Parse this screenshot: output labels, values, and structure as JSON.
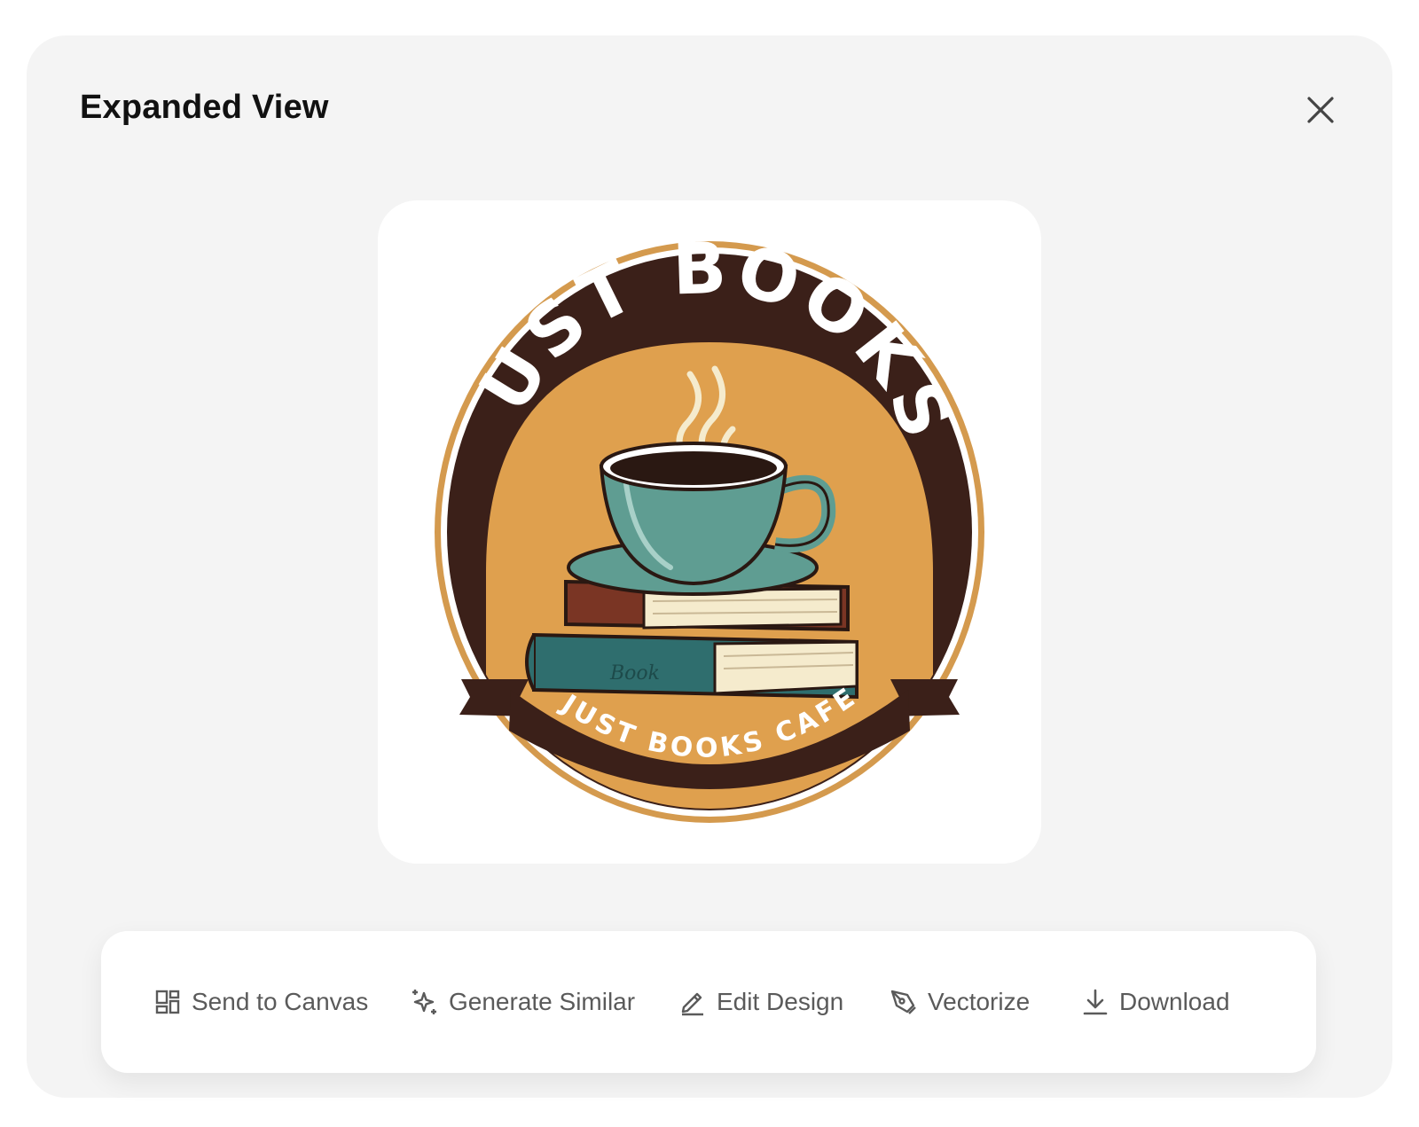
{
  "modal": {
    "title": "Expanded View",
    "close_icon": "close-icon"
  },
  "image": {
    "logo_top_text": "JUST BOOKS",
    "logo_banner_text": "JUST BOOKS CAFE",
    "book_spine_text": "Book",
    "colors": {
      "dark_brown": "#3b2019",
      "ring_gold": "#d49a4e",
      "orange": "#dfa04e",
      "teal": "#5f9d92",
      "dark_teal": "#2f6e6e",
      "cream": "#f5ebcd",
      "red_brown": "#7a3524"
    }
  },
  "toolbar": {
    "actions": [
      {
        "label": "Send to Canvas",
        "icon": "layout-grid-icon"
      },
      {
        "label": "Generate Similar",
        "icon": "sparkles-icon"
      },
      {
        "label": "Edit Design",
        "icon": "pencil-icon"
      },
      {
        "label": "Vectorize",
        "icon": "pen-tool-icon"
      },
      {
        "label": "Download",
        "icon": "download-icon"
      }
    ]
  }
}
